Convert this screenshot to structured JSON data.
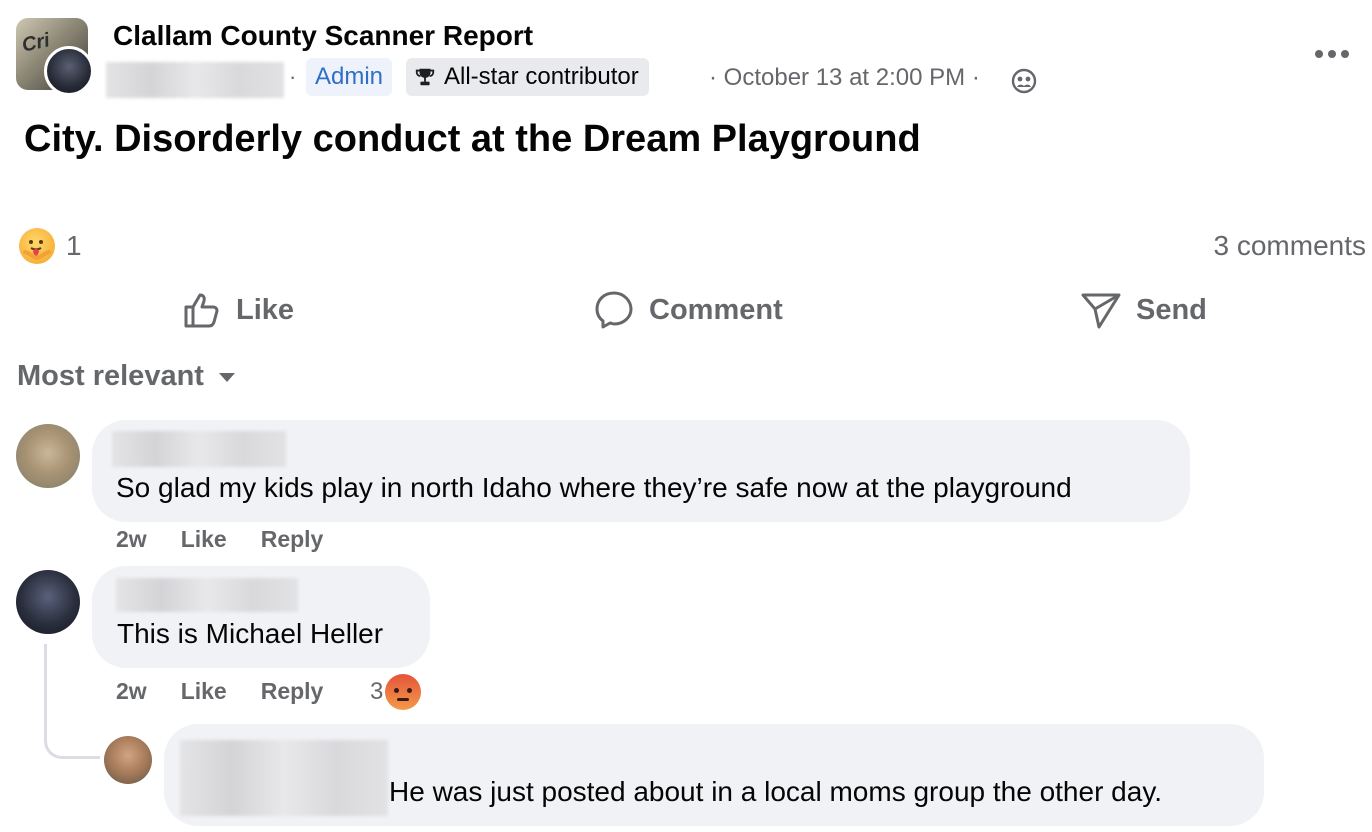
{
  "post": {
    "group_name": "Clallam County Scanner Report",
    "group_avatar_text": "Cri",
    "admin_badge": "Admin",
    "allstar_badge": "All-star contributor",
    "date": "October 13 at 2:00 PM",
    "separator": "·",
    "text": "City. Disorderly conduct at the Dream Playground"
  },
  "reactions": {
    "count": "1",
    "icon": "care-reaction-icon",
    "comments_count": "3 comments"
  },
  "actions": {
    "like": "Like",
    "comment": "Comment",
    "send": "Send"
  },
  "sort": {
    "label": "Most relevant"
  },
  "comments": [
    {
      "text": "So glad my kids play in north Idaho where they’re safe now at the playground",
      "time": "2w",
      "like": "Like",
      "reply": "Reply"
    },
    {
      "text": "This is Michael Heller",
      "time": "2w",
      "like": "Like",
      "reply": "Reply",
      "reaction_count": "3",
      "reaction_icon": "angry-reaction-icon"
    }
  ],
  "reply": {
    "text": "He was just posted about in a local moms group the other day."
  },
  "colors": {
    "secondary_text": "#65676b",
    "bubble": "#f0f2f5",
    "admin_blue": "#2f6fc9"
  }
}
